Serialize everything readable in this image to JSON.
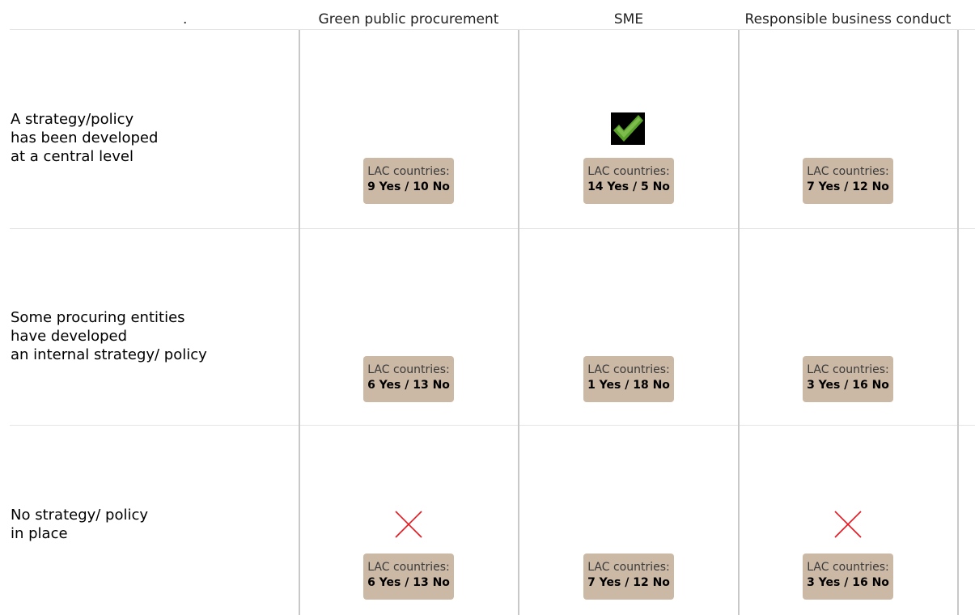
{
  "header": {
    "corner": ".",
    "columns": [
      "Green public procurement",
      "SME",
      "Responsible business conduct"
    ]
  },
  "rows": [
    {
      "label": [
        "A strategy/policy",
        "has been developed",
        "at a central level"
      ],
      "cells": [
        {
          "prefix": "LAC countries:",
          "counts": "9 Yes / 10 No",
          "mark": "none"
        },
        {
          "prefix": "LAC countries:",
          "counts": "14 Yes / 5 No",
          "mark": "check-icon"
        },
        {
          "prefix": "LAC countries:",
          "counts": "7 Yes / 12 No",
          "mark": "none"
        }
      ]
    },
    {
      "label": [
        "Some procuring entities",
        "have developed",
        "an internal strategy/ policy"
      ],
      "cells": [
        {
          "prefix": "LAC countries:",
          "counts": "6 Yes / 13 No",
          "mark": "none"
        },
        {
          "prefix": "LAC countries:",
          "counts": "1 Yes / 18 No",
          "mark": "none"
        },
        {
          "prefix": "LAC countries:",
          "counts": "3 Yes / 16 No",
          "mark": "none"
        }
      ]
    },
    {
      "label": [
        "No strategy/ policy",
        "in place"
      ],
      "cells": [
        {
          "prefix": "LAC countries:",
          "counts": "6 Yes / 13 No",
          "mark": "cross-icon"
        },
        {
          "prefix": "LAC countries:",
          "counts": "7 Yes / 12 No",
          "mark": "none"
        },
        {
          "prefix": "LAC countries:",
          "counts": "3 Yes / 16 No",
          "mark": "cross-icon"
        }
      ]
    }
  ],
  "colors": {
    "badge": "#cbb9a6",
    "check": "#5aa12c",
    "cross": "#e8141c"
  }
}
